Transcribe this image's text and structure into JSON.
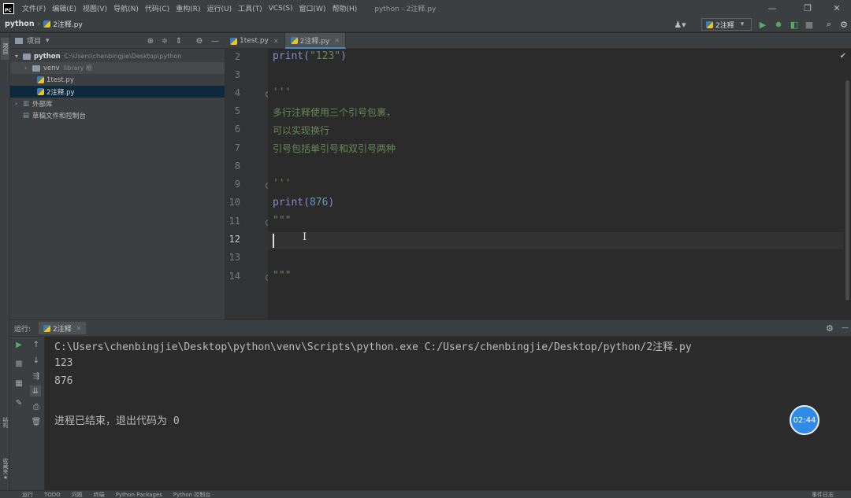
{
  "menubar": {
    "items": [
      "文件(F)",
      "编辑(E)",
      "视图(V)",
      "导航(N)",
      "代码(C)",
      "重构(R)",
      "运行(U)",
      "工具(T)",
      "VCS(S)",
      "窗口(W)",
      "帮助(H)"
    ],
    "window_title": "python - 2注释.py"
  },
  "navbar": {
    "project": "python",
    "file": "2注释.py",
    "run_config": "2注释"
  },
  "project_panel": {
    "title": "项目",
    "tree": [
      {
        "label": "python",
        "path": "C:\\Users\\chenbingjie\\Desktop\\python"
      },
      {
        "label": "venv",
        "path": "library 根"
      },
      {
        "label": "1test.py"
      },
      {
        "label": "2注释.py"
      },
      {
        "label": "外部库"
      },
      {
        "label": "草稿文件和控制台"
      }
    ]
  },
  "editor": {
    "tabs": [
      "1test.py",
      "2注释.py"
    ],
    "lines": [
      {
        "no": "2",
        "text": "print(\"123\")"
      },
      {
        "no": "3",
        "text": ""
      },
      {
        "no": "4",
        "text": "'''"
      },
      {
        "no": "5",
        "text": "多行注释使用三个引号包裹，"
      },
      {
        "no": "6",
        "text": "可以实现换行"
      },
      {
        "no": "7",
        "text": "引号包括单引号和双引号两种"
      },
      {
        "no": "8",
        "text": ""
      },
      {
        "no": "9",
        "text": "'''"
      },
      {
        "no": "10",
        "text": "print(876)"
      },
      {
        "no": "11",
        "text": "\"\"\""
      },
      {
        "no": "12",
        "text": ""
      },
      {
        "no": "13",
        "text": ""
      },
      {
        "no": "14",
        "text": "\"\"\""
      }
    ],
    "print1_fn": "print(",
    "print1_str": "\"123\"",
    "print1_close": ")",
    "print2_fn": "print(",
    "print2_num": "876",
    "print2_close": ")"
  },
  "run_panel": {
    "label": "运行:",
    "tab": "2注释",
    "console": [
      "C:\\Users\\chenbingjie\\Desktop\\python\\venv\\Scripts\\python.exe C:/Users/chenbingjie/Desktop/python/2注释.py",
      "123",
      "876",
      "",
      "进程已结束，退出代码为 0"
    ]
  },
  "statusbar": {
    "items": [
      "运行",
      "TODO",
      "问题",
      "终端",
      "Python Packages",
      "Python 控制台"
    ],
    "right": "事件日志"
  },
  "timer": "02:44",
  "colors": {
    "accent": "#4a88c7",
    "run_green": "#59a869",
    "timer_blue": "#2f8ae8"
  }
}
